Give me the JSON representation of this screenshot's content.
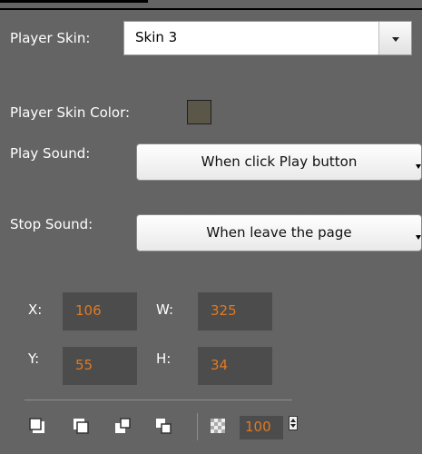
{
  "player_skin": {
    "label": "Player Skin:",
    "value": "Skin 3"
  },
  "player_skin_color": {
    "label": "Player Skin Color:",
    "color": "#5a5648"
  },
  "play_sound": {
    "label": "Play Sound:",
    "value": "When click Play button"
  },
  "stop_sound": {
    "label": "Stop Sound:",
    "value": "When leave the page"
  },
  "position": {
    "x_label": "X:",
    "x": "106",
    "w_label": "W:",
    "w": "325",
    "y_label": "Y:",
    "y": "55",
    "h_label": "H:",
    "h": "34"
  },
  "toolbar": {
    "icons": [
      "bring-to-front-icon",
      "send-to-back-icon",
      "bring-forward-icon",
      "send-backward-icon",
      "opacity-icon"
    ],
    "opacity": "100"
  },
  "colors": {
    "panel_bg": "#646464",
    "field_bg": "#4c4c4c",
    "value_text": "#e07a22"
  }
}
